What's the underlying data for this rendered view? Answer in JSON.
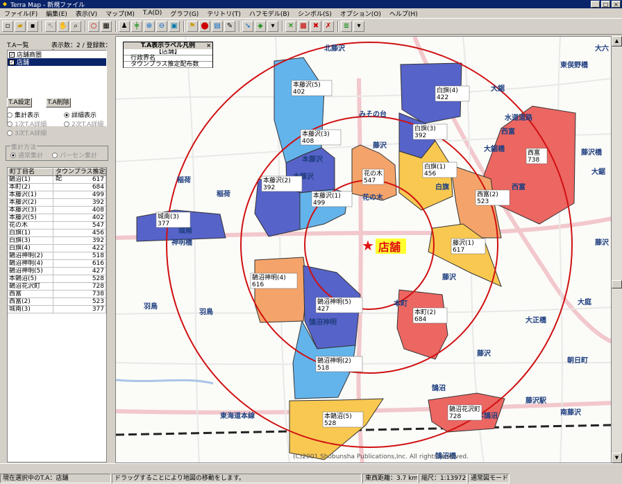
{
  "window": {
    "title": "Terra Map - 新規ファイル",
    "min": "_",
    "max": "□",
    "close": "×"
  },
  "menu": [
    "ファイル(F)",
    "編集(E)",
    "表示(V)",
    "マップ(M)",
    "T.A(D)",
    "グラフ(G)",
    "テリトリ(T)",
    "ハフモデル(B)",
    "シンボル(S)",
    "オプション(O)",
    "ヘルプ(H)"
  ],
  "left": {
    "ta_list_label": "T.A一覧",
    "count_label": "表示数：2 / 登録数：2",
    "ta_items": [
      "店舗商圏",
      "店舗"
    ],
    "btn_ta_setting": "T.A設定",
    "btn_ta_delete": "T.A削除",
    "radio_summary": "集計表示",
    "radio_detail": "詳細表示",
    "radio_first": "1次T.A詳細",
    "radio_second": "2次T.A詳細",
    "radio_third": "3次T.A詳細",
    "group_label": "集計方法",
    "radio_normal": "通常集計",
    "radio_percent": "パーセン集計",
    "table_headers": [
      "町丁目名",
      "タウンプラス推定配"
    ],
    "rows": [
      [
        "鵠沼(1)",
        "617"
      ],
      [
        "本町(2)",
        "684"
      ],
      [
        "本藤沢(1)",
        "499"
      ],
      [
        "本藤沢(2)",
        "392"
      ],
      [
        "本藤沢(3)",
        "408"
      ],
      [
        "本藤沢(5)",
        "402"
      ],
      [
        "花の木",
        "547"
      ],
      [
        "白旗(1)",
        "456"
      ],
      [
        "白旗(3)",
        "392"
      ],
      [
        "白旗(4)",
        "422"
      ],
      [
        "鵠沼神明(2)",
        "518"
      ],
      [
        "鵠沼神明(4)",
        "616"
      ],
      [
        "鵠沼神明(5)",
        "427"
      ],
      [
        "本鵠沼(5)",
        "528"
      ],
      [
        "鵠沼花沢町",
        "728"
      ],
      [
        "西富",
        "738"
      ],
      [
        "西富(2)",
        "523"
      ],
      [
        "城南(3)",
        "377"
      ]
    ]
  },
  "legend": {
    "title": "T.A表示ラベル凡例",
    "subtitle": "【店舗】",
    "row1": "行政界名",
    "row2": "タウンプラス推定配布数",
    "close": "×"
  },
  "map": {
    "store_label": "店舗",
    "copyright": "(C)2001 Shobunsha Publications,Inc. All rights reserved.",
    "area_labels": [
      {
        "name": "本藤沢(5)",
        "value": "402"
      },
      {
        "name": "白旗(4)",
        "value": "422"
      },
      {
        "name": "白旗(3)",
        "value": "392"
      },
      {
        "name": "本藤沢(3)",
        "value": "408"
      },
      {
        "name": "西富",
        "value": "738"
      },
      {
        "name": "白旗(1)",
        "value": "456"
      },
      {
        "name": "花の木",
        "value": "547"
      },
      {
        "name": "本藤沢(2)",
        "value": "392"
      },
      {
        "name": "西富(2)",
        "value": "523"
      },
      {
        "name": "本藤沢(1)",
        "value": "499"
      },
      {
        "name": "城南(3)",
        "value": "377"
      },
      {
        "name": "藤沢(1)",
        "value": "617"
      },
      {
        "name": "鵠沼神明(4)",
        "value": "616"
      },
      {
        "name": "鵠沼神明(5)",
        "value": "427"
      },
      {
        "name": "本町(2)",
        "value": "684"
      },
      {
        "name": "鵠沼神明(2)",
        "value": "518"
      },
      {
        "name": "本鵠沼(5)",
        "value": "528"
      },
      {
        "name": "鵠沼花沢町",
        "value": "728"
      }
    ],
    "place_names": [
      "みその台",
      "稲荷",
      "稲荷",
      "羽鳥",
      "羽鳥",
      "藤沢",
      "大鋸",
      "大鋸",
      "西富",
      "西富",
      "本町",
      "藤沢",
      "朝日町",
      "鵠沼",
      "本鵠沼",
      "藤沢駅",
      "南藤沢",
      "鵠沼橋",
      "東海道本線",
      "大正橋",
      "大庭",
      "藤沢",
      "白旗",
      "本藤沢",
      "花の木",
      "鵠沼神明",
      "東俣野橋",
      "水道道路",
      "大鋸橋",
      "藤沢橋",
      "大六",
      "北藤沢",
      "神明橋",
      "城南",
      "藤沢",
      "本藤沢"
    ]
  },
  "status": {
    "selected": "現在選択中のT.A：店舗",
    "hint": "ドラッグすることにより地図の移動をします。",
    "distance": "東西距離：3.7 km",
    "scale": "縮尺：1:13972",
    "mode": "通常図モード"
  }
}
